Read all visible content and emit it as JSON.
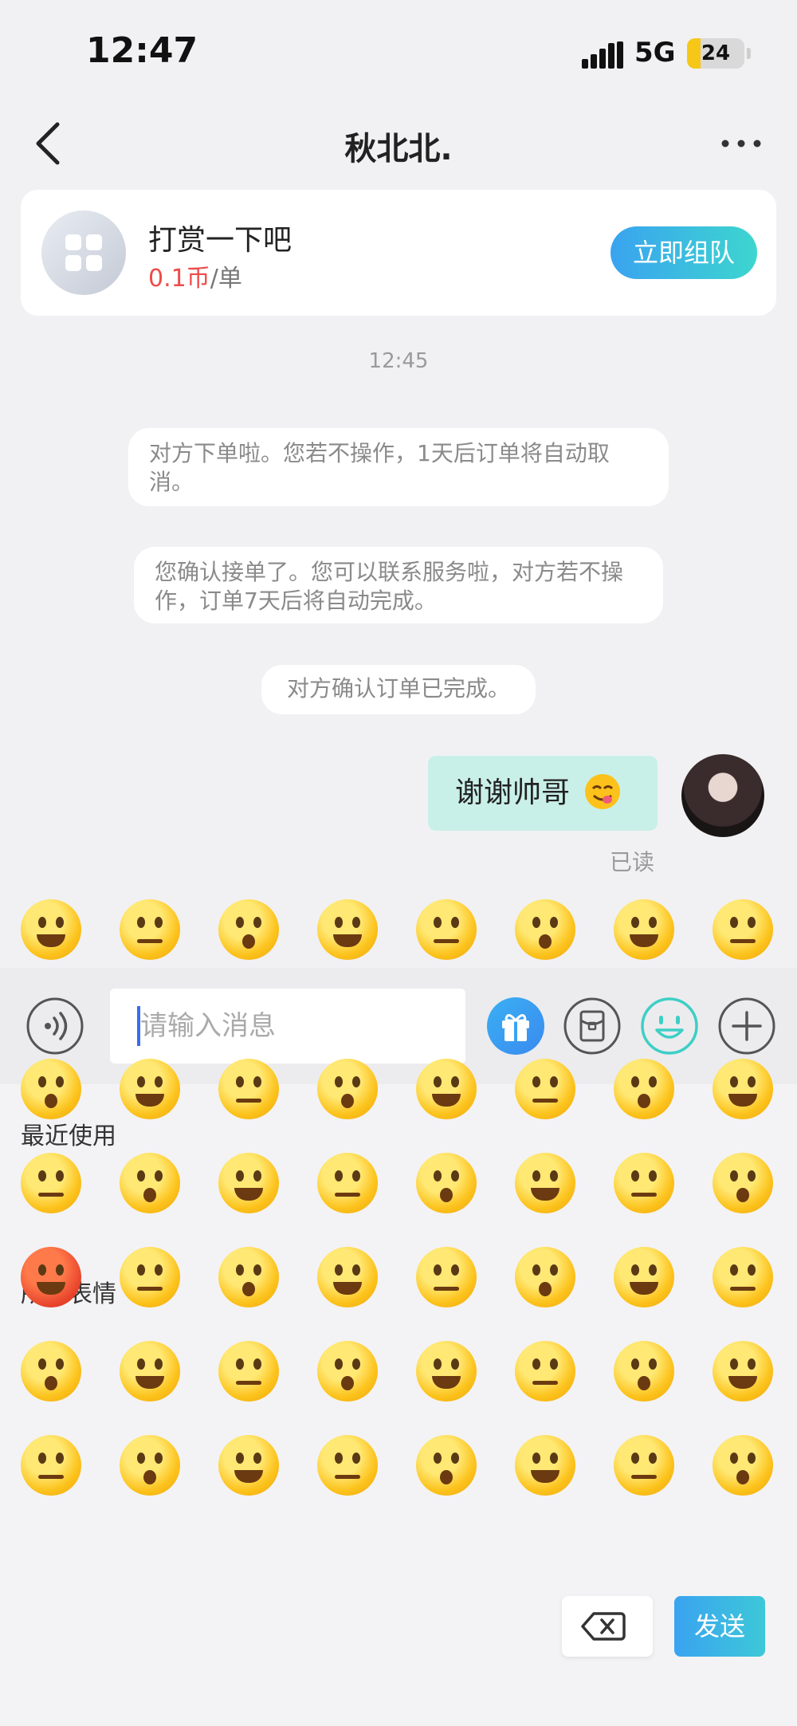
{
  "status_bar": {
    "time": "12:47",
    "network": "5G",
    "battery": "24"
  },
  "nav": {
    "title": "秋北北."
  },
  "order_card": {
    "title": "打赏一下吧",
    "price": "0.1币",
    "unit": "/单",
    "button": "立即组队"
  },
  "chat": {
    "timestamp": "12:45",
    "system_messages": [
      "对方下单啦。您若不操作，1天后订单将自动取消。",
      "您确认接单了。您可以联系服务啦，对方若不操作，订单7天后将自动完成。",
      "对方确认订单已完成。"
    ],
    "my_message": "谢谢帅哥",
    "read_status": "已读"
  },
  "input": {
    "placeholder": "请输入消息"
  },
  "emoji_panel": {
    "recent_label": "最近使用",
    "all_label": "所有表情",
    "send_label": "发送"
  },
  "icons": [
    "back-icon",
    "more-icon",
    "voice-icon",
    "gift-icon",
    "red-packet-icon",
    "emoji-icon",
    "plus-icon",
    "backspace-icon"
  ],
  "colors": {
    "accent_start": "#3aa3f0",
    "accent_end": "#3dd6cf",
    "price_red": "#ee4b4b",
    "my_bubble": "#c9f0e8"
  }
}
